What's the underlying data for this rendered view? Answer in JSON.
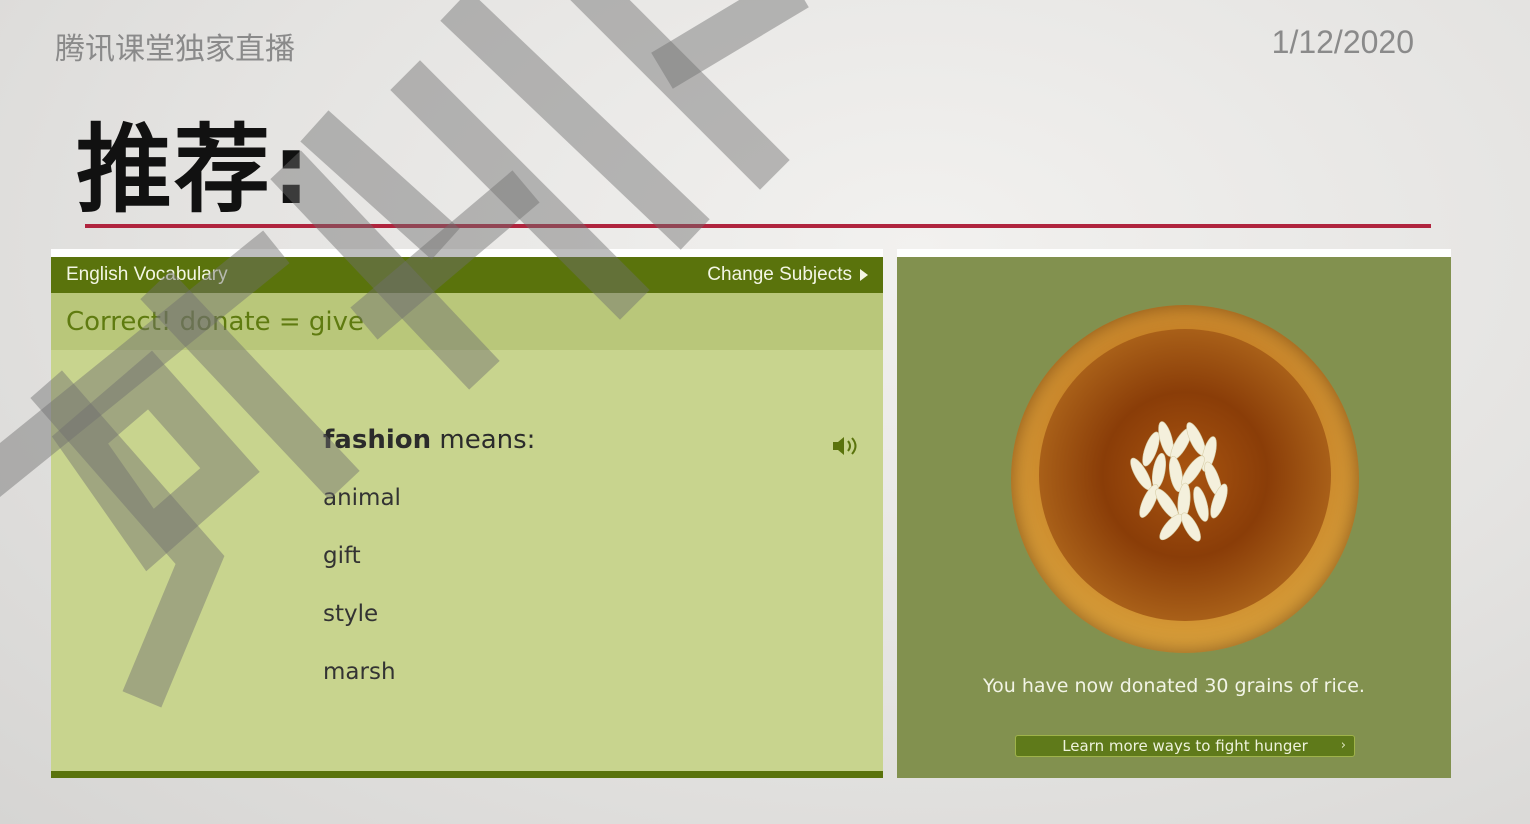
{
  "slide": {
    "header_left": "腾讯课堂独家直播",
    "date": "1/12/2020",
    "title": "推荐:"
  },
  "quiz": {
    "subject": "English Vocabulary",
    "change_subjects": "Change Subjects",
    "feedback": "Correct! donate = give",
    "word": "fashion",
    "means": " means:",
    "options": [
      "animal",
      "gift",
      "style",
      "marsh"
    ]
  },
  "panel": {
    "donated_text": "You have now donated 30 grains of rice.",
    "learn_button": "Learn more ways to fight hunger"
  },
  "colors": {
    "accent_red": "#b0243e",
    "quiz_bar": "#5a730c",
    "quiz_bg": "#c8d48e",
    "panel_bg": "#82914f"
  }
}
